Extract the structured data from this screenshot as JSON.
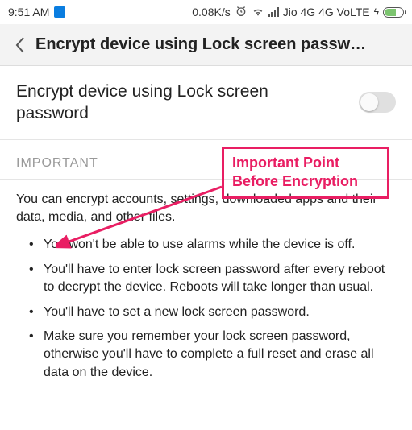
{
  "status": {
    "time": "9:51 AM",
    "speed": "0.08K/s",
    "carrier": "Jio 4G 4G VoLTE"
  },
  "header": {
    "title": "Encrypt device using Lock screen passw…"
  },
  "toggle": {
    "label": "Encrypt device using Lock screen password",
    "enabled": false
  },
  "section_label": "IMPORTANT",
  "intro_text": "You can encrypt accounts, settings, downloaded apps and their data, media, and other files.",
  "bullets": [
    "You won't be able to use alarms while the device is off.",
    "You'll have to enter lock screen password after every reboot to decrypt the device. Reboots will take longer than usual.",
    "You'll have to set a new lock screen password.",
    "Make sure you remember your lock screen password, otherwise you'll have to complete a full reset and erase all data on the device."
  ],
  "annotation": {
    "line1": "Important Point",
    "line2": "Before Encryption"
  }
}
